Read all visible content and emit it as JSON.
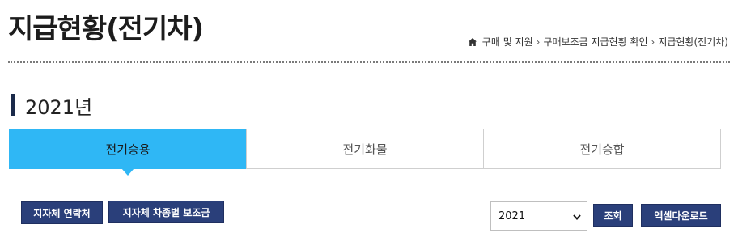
{
  "page": {
    "title": "지급현황(전기차)"
  },
  "breadcrumb": {
    "items": [
      "구매 및 지원",
      "구매보조금 지급현황 확인",
      "지급현황(전기차)"
    ]
  },
  "section": {
    "year_heading": "2021년"
  },
  "tabs": [
    {
      "label": "전기승용",
      "active": true
    },
    {
      "label": "전기화물",
      "active": false
    },
    {
      "label": "전기승합",
      "active": false
    }
  ],
  "actions": {
    "contact_label": "지자체 연락처",
    "subsidy_label": "지자체 차종별 보조금",
    "year_select_value": "2021",
    "search_label": "조회",
    "excel_label": "엑셀다운로드"
  },
  "colors": {
    "accent": "#2fb7f5",
    "button": "#2a3f7a",
    "heading_bar": "#1b2a4a"
  },
  "icons": {
    "home": "home-icon",
    "separator": "chevron-right-icon",
    "select": "chevron-down-icon"
  }
}
